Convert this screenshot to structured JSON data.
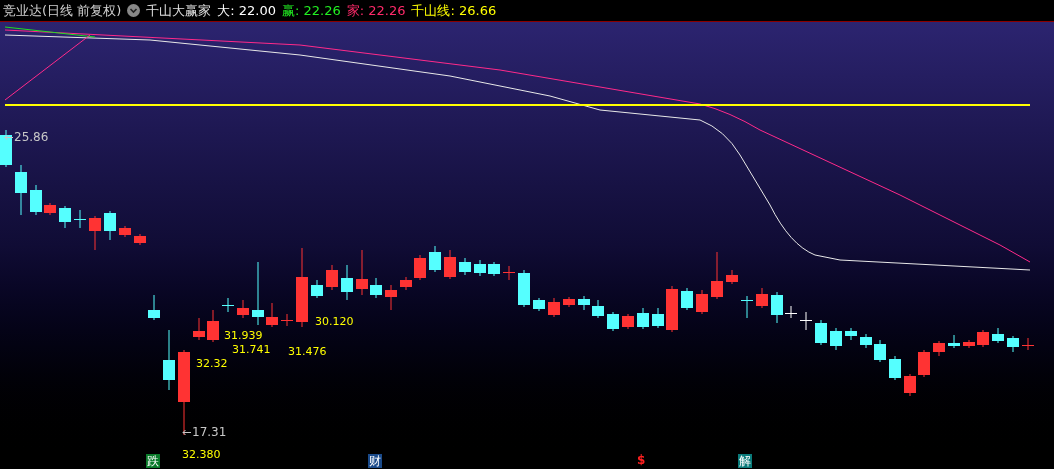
{
  "header": {
    "title": "竞业达(日线 前复权)",
    "indicator": "千山大赢家",
    "readings": [
      {
        "text": "大: 22.00",
        "color": "#ffffff"
      },
      {
        "text": "赢: 22.26",
        "color": "#22ee22"
      },
      {
        "text": "家: 22.26",
        "color": "#ff2a6a"
      },
      {
        "text": "千山线: 26.66",
        "color": "#ffff00"
      }
    ]
  },
  "price_marks": [
    {
      "text": "25.86",
      "kind": "high"
    },
    {
      "text": "17.31",
      "kind": "low"
    }
  ],
  "value_labels": [
    "30.120",
    "31.939",
    "31.741",
    "31.476",
    "32.32",
    "32.380"
  ],
  "event_marks": [
    {
      "text": "跌",
      "kind": "badge",
      "color": "#0a7a2a"
    },
    {
      "text": "财",
      "kind": "badge",
      "color": "#1a4a8a"
    },
    {
      "text": "$",
      "kind": "glyph",
      "color": "#ff2020"
    },
    {
      "text": "解",
      "kind": "badge",
      "color": "#0a7a7a"
    }
  ]
}
